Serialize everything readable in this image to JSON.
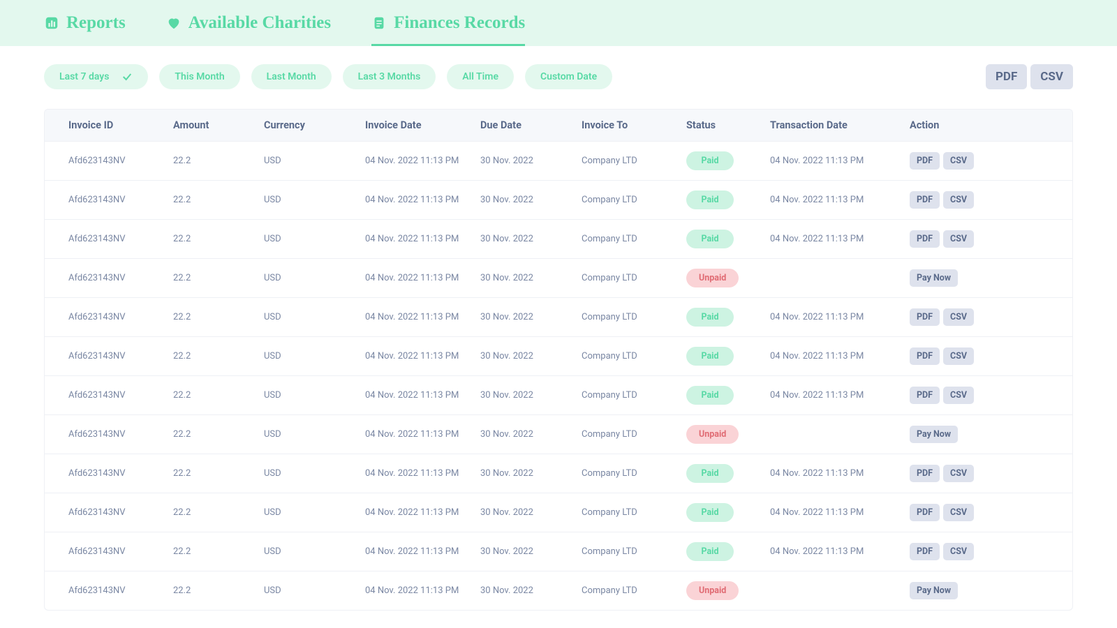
{
  "nav": {
    "tabs": [
      {
        "label": "Reports",
        "icon": "bar-chart"
      },
      {
        "label": "Available Charities",
        "icon": "heart"
      },
      {
        "label": "Finances Records",
        "icon": "document",
        "active": true
      }
    ]
  },
  "filters": [
    {
      "label": "Last 7 days",
      "selected": true
    },
    {
      "label": "This Month"
    },
    {
      "label": "Last Month"
    },
    {
      "label": "Last 3 Months"
    },
    {
      "label": "All Time"
    },
    {
      "label": "Custom Date"
    }
  ],
  "export": {
    "pdf": "PDF",
    "csv": "CSV"
  },
  "table": {
    "columns": [
      "Invoice ID",
      "Amount",
      "Currency",
      "Invoice Date",
      "Due Date",
      "Invoice To",
      "Status",
      "Transaction Date",
      "Action"
    ],
    "actions": {
      "pdf": "PDF",
      "csv": "CSV",
      "pay": "Pay Now"
    },
    "rows": [
      {
        "invoice_id": "Afd623143NV",
        "amount": "22.2",
        "currency": "USD",
        "invoice_date": "04 Nov. 2022 11:13 PM",
        "due_date": "30 Nov. 2022",
        "invoice_to": "Company LTD",
        "status": "Paid",
        "transaction_date": "04 Nov. 2022 11:13 PM"
      },
      {
        "invoice_id": "Afd623143NV",
        "amount": "22.2",
        "currency": "USD",
        "invoice_date": "04 Nov. 2022 11:13 PM",
        "due_date": "30 Nov. 2022",
        "invoice_to": "Company LTD",
        "status": "Paid",
        "transaction_date": "04 Nov. 2022 11:13 PM"
      },
      {
        "invoice_id": "Afd623143NV",
        "amount": "22.2",
        "currency": "USD",
        "invoice_date": "04 Nov. 2022 11:13 PM",
        "due_date": "30 Nov. 2022",
        "invoice_to": "Company LTD",
        "status": "Paid",
        "transaction_date": "04 Nov. 2022 11:13 PM"
      },
      {
        "invoice_id": "Afd623143NV",
        "amount": "22.2",
        "currency": "USD",
        "invoice_date": "04 Nov. 2022 11:13 PM",
        "due_date": "30 Nov. 2022",
        "invoice_to": "Company LTD",
        "status": "Unpaid",
        "transaction_date": ""
      },
      {
        "invoice_id": "Afd623143NV",
        "amount": "22.2",
        "currency": "USD",
        "invoice_date": "04 Nov. 2022 11:13 PM",
        "due_date": "30 Nov. 2022",
        "invoice_to": "Company LTD",
        "status": "Paid",
        "transaction_date": "04 Nov. 2022 11:13 PM"
      },
      {
        "invoice_id": "Afd623143NV",
        "amount": "22.2",
        "currency": "USD",
        "invoice_date": "04 Nov. 2022 11:13 PM",
        "due_date": "30 Nov. 2022",
        "invoice_to": "Company LTD",
        "status": "Paid",
        "transaction_date": "04 Nov. 2022 11:13 PM"
      },
      {
        "invoice_id": "Afd623143NV",
        "amount": "22.2",
        "currency": "USD",
        "invoice_date": "04 Nov. 2022 11:13 PM",
        "due_date": "30 Nov. 2022",
        "invoice_to": "Company LTD",
        "status": "Paid",
        "transaction_date": "04 Nov. 2022 11:13 PM"
      },
      {
        "invoice_id": "Afd623143NV",
        "amount": "22.2",
        "currency": "USD",
        "invoice_date": "04 Nov. 2022 11:13 PM",
        "due_date": "30 Nov. 2022",
        "invoice_to": "Company LTD",
        "status": "Unpaid",
        "transaction_date": ""
      },
      {
        "invoice_id": "Afd623143NV",
        "amount": "22.2",
        "currency": "USD",
        "invoice_date": "04 Nov. 2022 11:13 PM",
        "due_date": "30 Nov. 2022",
        "invoice_to": "Company LTD",
        "status": "Paid",
        "transaction_date": "04 Nov. 2022 11:13 PM"
      },
      {
        "invoice_id": "Afd623143NV",
        "amount": "22.2",
        "currency": "USD",
        "invoice_date": "04 Nov. 2022 11:13 PM",
        "due_date": "30 Nov. 2022",
        "invoice_to": "Company LTD",
        "status": "Paid",
        "transaction_date": "04 Nov. 2022 11:13 PM"
      },
      {
        "invoice_id": "Afd623143NV",
        "amount": "22.2",
        "currency": "USD",
        "invoice_date": "04 Nov. 2022 11:13 PM",
        "due_date": "30 Nov. 2022",
        "invoice_to": "Company LTD",
        "status": "Paid",
        "transaction_date": "04 Nov. 2022 11:13 PM"
      },
      {
        "invoice_id": "Afd623143NV",
        "amount": "22.2",
        "currency": "USD",
        "invoice_date": "04 Nov. 2022 11:13 PM",
        "due_date": "30 Nov. 2022",
        "invoice_to": "Company LTD",
        "status": "Unpaid",
        "transaction_date": ""
      }
    ]
  }
}
